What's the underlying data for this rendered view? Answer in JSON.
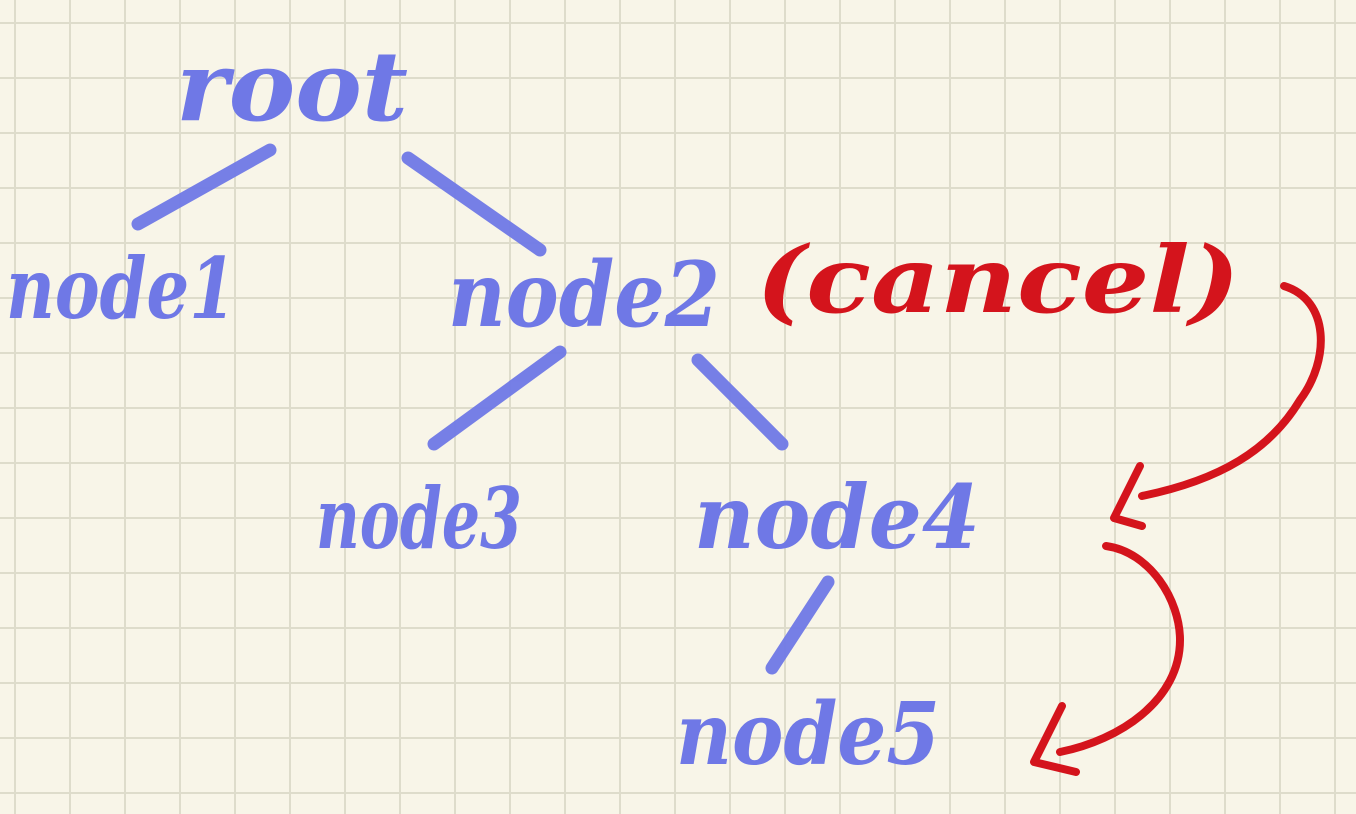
{
  "colors": {
    "paper": "#f8f5e8",
    "grid": "#dedccb",
    "tree_ink": "#6f78e6",
    "annotation_ink": "#d4141c"
  },
  "nodes": {
    "root": "root",
    "node1": "node1",
    "node2": "node2",
    "node3": "node3",
    "node4": "node4",
    "node5": "node5"
  },
  "annotation": {
    "cancel": "(cancel)"
  },
  "edges": [
    {
      "from": "root",
      "to": "node1"
    },
    {
      "from": "root",
      "to": "node2"
    },
    {
      "from": "node2",
      "to": "node3"
    },
    {
      "from": "node2",
      "to": "node4"
    },
    {
      "from": "node4",
      "to": "node5"
    }
  ],
  "arrows": [
    {
      "from": "node2",
      "to": "node4"
    },
    {
      "from": "node4",
      "to": "node5"
    }
  ]
}
